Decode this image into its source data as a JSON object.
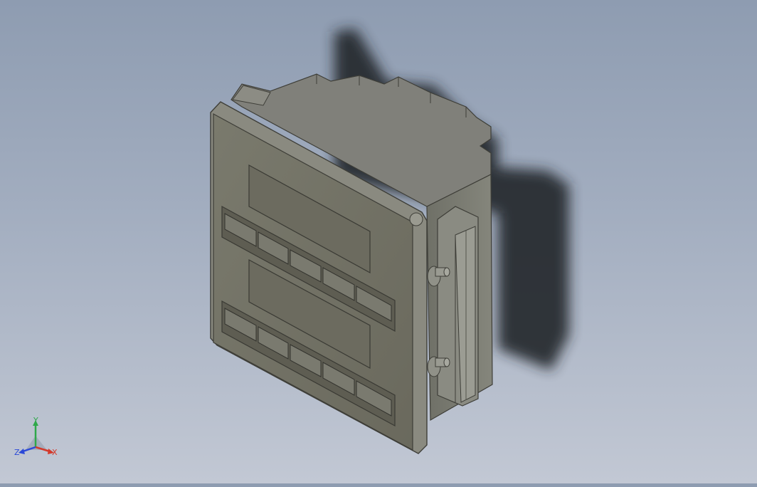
{
  "viewport": {
    "model": "panel-mount-meter-with-dual-display-and-button-rows",
    "background_top": "#8e9cb1",
    "background_bottom": "#c2c8d4",
    "body_color": "#7e7f76",
    "face_color": "#706f63",
    "display_count": 2,
    "button_rows": 2,
    "buttons_per_row": 5,
    "mounting_clip_screws": 2
  },
  "triad": {
    "x_label": "X",
    "y_label": "Y",
    "z_label": "Z",
    "x_color": "#d33a2c",
    "y_color": "#2fa84a",
    "z_color": "#2b49d8"
  }
}
